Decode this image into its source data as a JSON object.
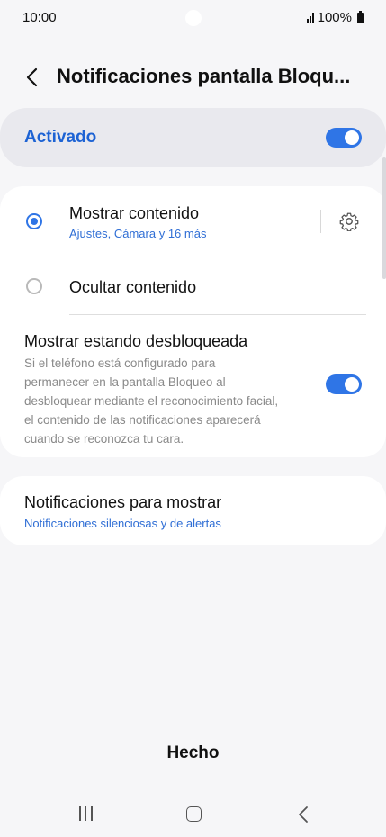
{
  "status": {
    "time": "10:00",
    "battery": "100%"
  },
  "header": {
    "title": "Notificaciones pantalla Bloqu..."
  },
  "master": {
    "label": "Activado",
    "enabled": true
  },
  "options": {
    "show_content": {
      "title": "Mostrar contenido",
      "subtitle": "Ajustes, Cámara y 16 más",
      "selected": true
    },
    "hide_content": {
      "title": "Ocultar contenido",
      "selected": false
    },
    "show_unlocked": {
      "title": "Mostrar estando desbloqueada",
      "line1": "Si el teléfono está configurado para",
      "line2": "permanecer en la pantalla Bloqueo al",
      "line3": "desbloquear mediante el reconocimiento facial,",
      "line4": "el contenido de las notificaciones aparecerá",
      "line5": "cuando se reconozca tu cara.",
      "enabled": true
    }
  },
  "notifications_to_show": {
    "title": "Notificaciones para mostrar",
    "value": "Notificaciones silenciosas y de alertas"
  },
  "footer": {
    "done_label": "Hecho"
  },
  "colors": {
    "accent": "#2f75e6",
    "background": "#f6f6f8"
  },
  "icons": {
    "back": "chevron-left-icon",
    "settings": "gear-icon"
  }
}
